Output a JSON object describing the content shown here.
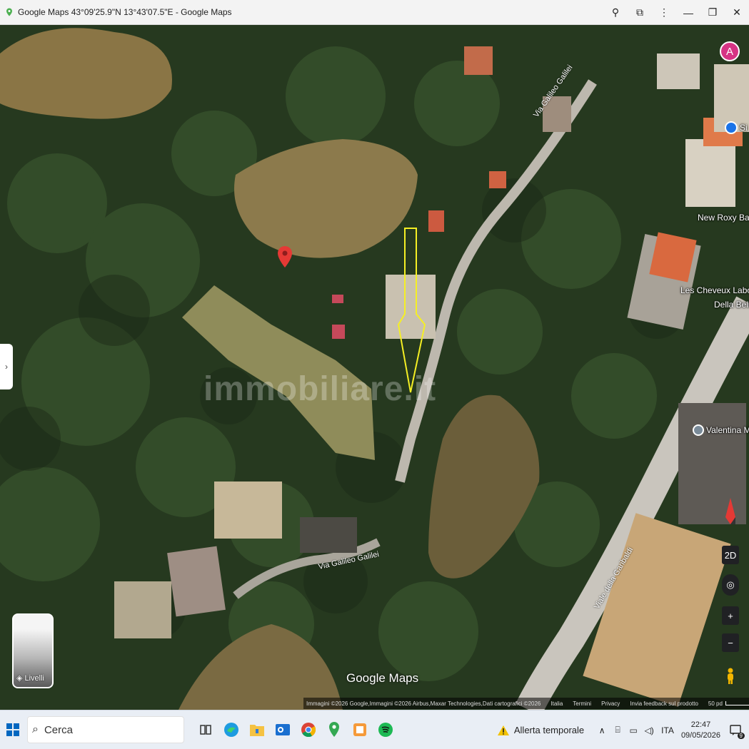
{
  "window": {
    "title": "Google Maps 43°09'25.9\"N 13°43'07.5\"E - Google Maps",
    "actions": [
      {
        "name": "location-icon",
        "glyph": "⚲"
      },
      {
        "name": "extensions-icon",
        "glyph": "⧉"
      },
      {
        "name": "more-icon",
        "glyph": "⋮"
      },
      {
        "name": "minimize-icon",
        "glyph": "—"
      },
      {
        "name": "maximize-icon",
        "glyph": "❐"
      },
      {
        "name": "close-icon",
        "glyph": "✕"
      }
    ]
  },
  "map": {
    "avatar_letter": "A",
    "places": {
      "si": "Si",
      "new_roxy_bar": "New Roxy Bar",
      "les_cheveux_1": "Les Cheveux Laborat",
      "les_cheveux_2": "Della Bella",
      "valentina": "Valentina M"
    },
    "roads": {
      "via_galileo_top": "Via Galileo Galilei",
      "via_galileo_bottom": "Via Galileo Galilei",
      "viale_garibaldi": "Viale della Garibaldi"
    },
    "watermark": "immobiliare.it",
    "logo": "Google Maps",
    "layers_label": "Livelli",
    "controls": {
      "view_2d": "2D",
      "zoom_in": "+",
      "zoom_out": "−"
    },
    "attribution": {
      "imagery": "Immagini ©2026 Google,Immagini ©2026 Airbus,Maxar Technologies,Dati cartografici ©2026",
      "country": "Italia",
      "terms": "Termini",
      "privacy": "Privacy",
      "feedback": "Invia feedback sul prodotto",
      "scale": "50 pd"
    },
    "colors": {
      "pin": "#e53935",
      "outline": "#f5ef24",
      "avatar": "#d63384"
    }
  },
  "taskbar": {
    "search_placeholder": "Cerca",
    "weather": "Allerta temporale",
    "language": "ITA",
    "time": "22:47",
    "date": "09/05/2026",
    "notifications": "9"
  }
}
